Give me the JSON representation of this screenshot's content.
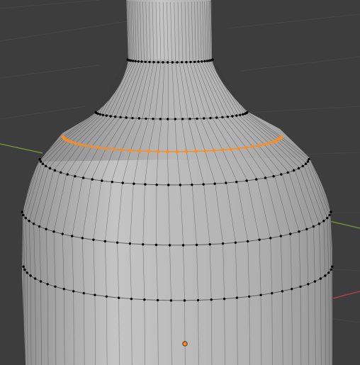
{
  "viewport": {
    "mode": "Edit Mode",
    "select_mode": "vertex",
    "object_name": "Bottle",
    "background_color": "#3d3d3d",
    "grid_color": "#474747",
    "axis_x_color": "#b8434f",
    "axis_y_color": "#7a9b3a",
    "mesh_face_color": "#b5b5b5",
    "mesh_edge_color": "#3a3a3a",
    "vertex_color": "#000000",
    "selected_color": "#ff8c1a",
    "selected_edge_loop": "ring-3",
    "origin_icon": "object-origin-icon"
  }
}
